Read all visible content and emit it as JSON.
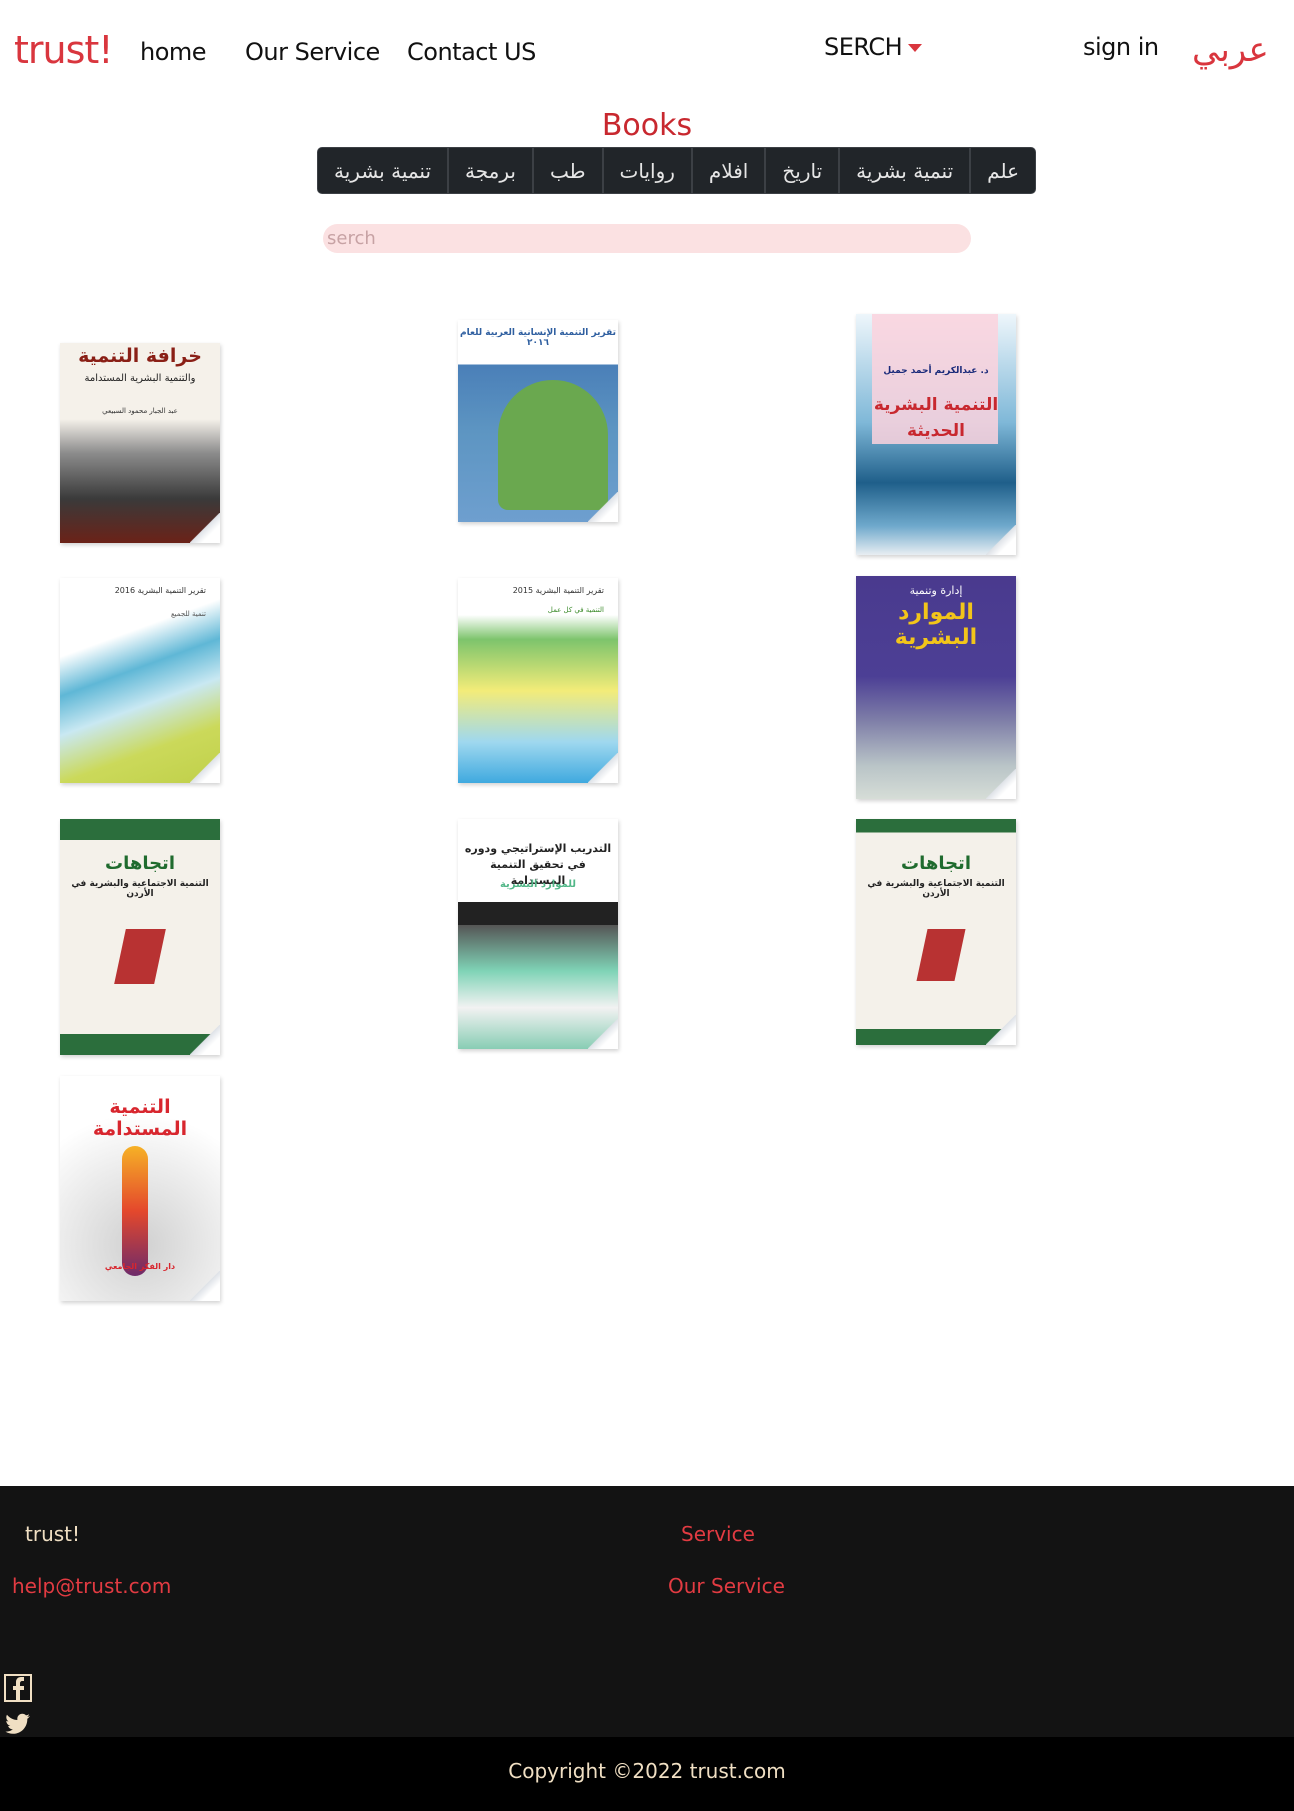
{
  "nav": {
    "brand": "trust!",
    "links": [
      "home",
      "Our Service",
      "Contact US"
    ],
    "search_dropdown": "SERCH",
    "sign_in": "sign in",
    "language": "عربي"
  },
  "books_section": {
    "title": "Books",
    "categories": [
      "تنمية بشرية",
      "برمجة",
      "طب",
      "روايات",
      "افلام",
      "تاريخ",
      "تنمية بشرية",
      "علم"
    ],
    "search_placeholder": "serch"
  },
  "books": [
    {
      "cover_title": "خرافة التنمية",
      "cover_subtitle": "والتنمية البشرية المستدامة",
      "cover_author": "عبد الجبار محمود السبيعي"
    },
    {
      "cover_title": "تقرير التنمية الإنسانية العربية للعام ٢٠١٦",
      "cover_subtitle": ""
    },
    {
      "cover_title": "التنمية البشرية الحديثة",
      "cover_subtitle": "د. عبدالكريم أحمد جميل"
    },
    {
      "cover_title": "تقرير التنمية البشرية 2016",
      "cover_subtitle": "تنمية للجميع"
    },
    {
      "cover_title": "تقرير التنمية البشرية 2015",
      "cover_subtitle": "التنمية في كل عمل"
    },
    {
      "cover_title": "الموارد البشرية",
      "cover_subtitle": "إدارة وتنمية"
    },
    {
      "cover_title": "اتجاهات",
      "cover_subtitle": "التنمية الاجتماعية والبشرية في الأردن"
    },
    {
      "cover_title": "التدريب الإستراتيجي ودوره في تحقيق التنمية المستدامة",
      "cover_subtitle": "للموارد البشرية"
    },
    {
      "cover_title": "اتجاهات",
      "cover_subtitle": "التنمية الاجتماعية والبشرية في الأردن"
    },
    {
      "cover_title": "التنمية المستدامة",
      "cover_subtitle": "دار الفكر الجامعي"
    }
  ],
  "footer": {
    "brand": "trust!",
    "email": "help@trust.com",
    "service_heading": "Service",
    "service_link": "Our Service",
    "social": [
      "facebook-icon",
      "twitter-icon"
    ],
    "copyright": "Copyright ©2022 trust.com"
  }
}
